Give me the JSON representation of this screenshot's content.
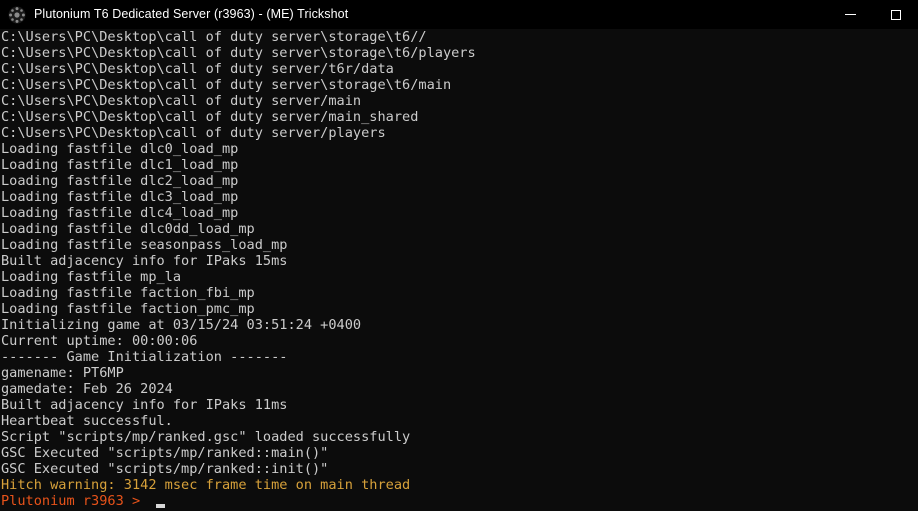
{
  "titlebar": {
    "icon": "plutonium-logo-icon",
    "title": "Plutonium T6 Dedicated Server (r3963) - (ME) Trickshot",
    "minimize_label": "Minimize",
    "maximize_label": "Maximize"
  },
  "colors": {
    "background": "#0c0c0c",
    "titlebar_background": "#000000",
    "text": "#cccccc",
    "warning": "#d7a13a",
    "prompt": "#e8531a",
    "cursor": "#d8d8d8"
  },
  "console": {
    "lines": [
      {
        "text": "C:\\Users\\PC\\Desktop\\call of duty server\\storage\\t6//",
        "style": "normal"
      },
      {
        "text": "C:\\Users\\PC\\Desktop\\call of duty server\\storage\\t6/players",
        "style": "normal"
      },
      {
        "text": "C:\\Users\\PC\\Desktop\\call of duty server/t6r/data",
        "style": "normal"
      },
      {
        "text": "C:\\Users\\PC\\Desktop\\call of duty server\\storage\\t6/main",
        "style": "normal"
      },
      {
        "text": "C:\\Users\\PC\\Desktop\\call of duty server/main",
        "style": "normal"
      },
      {
        "text": "C:\\Users\\PC\\Desktop\\call of duty server/main_shared",
        "style": "normal"
      },
      {
        "text": "C:\\Users\\PC\\Desktop\\call of duty server/players",
        "style": "normal"
      },
      {
        "text": "Loading fastfile dlc0_load_mp",
        "style": "normal"
      },
      {
        "text": "Loading fastfile dlc1_load_mp",
        "style": "normal"
      },
      {
        "text": "Loading fastfile dlc2_load_mp",
        "style": "normal"
      },
      {
        "text": "Loading fastfile dlc3_load_mp",
        "style": "normal"
      },
      {
        "text": "Loading fastfile dlc4_load_mp",
        "style": "normal"
      },
      {
        "text": "Loading fastfile dlc0dd_load_mp",
        "style": "normal"
      },
      {
        "text": "Loading fastfile seasonpass_load_mp",
        "style": "normal"
      },
      {
        "text": "Built adjacency info for IPaks 15ms",
        "style": "normal"
      },
      {
        "text": "Loading fastfile mp_la",
        "style": "normal"
      },
      {
        "text": "Loading fastfile faction_fbi_mp",
        "style": "normal"
      },
      {
        "text": "Loading fastfile faction_pmc_mp",
        "style": "normal"
      },
      {
        "text": "Initializing game at 03/15/24 03:51:24 +0400",
        "style": "normal"
      },
      {
        "text": "Current uptime: 00:00:06",
        "style": "normal"
      },
      {
        "text": "------- Game Initialization -------",
        "style": "normal"
      },
      {
        "text": "gamename: PT6MP",
        "style": "normal"
      },
      {
        "text": "gamedate: Feb 26 2024",
        "style": "normal"
      },
      {
        "text": "Built adjacency info for IPaks 11ms",
        "style": "normal"
      },
      {
        "text": "Heartbeat successful.",
        "style": "normal"
      },
      {
        "text": "Script \"scripts/mp/ranked.gsc\" loaded successfully",
        "style": "normal"
      },
      {
        "text": "GSC Executed \"scripts/mp/ranked::main()\"",
        "style": "normal"
      },
      {
        "text": "GSC Executed \"scripts/mp/ranked::init()\"",
        "style": "normal"
      },
      {
        "text": "Hitch warning: 3142 msec frame time on main thread",
        "style": "warn"
      },
      {
        "text": "Plutonium r3963 > ",
        "style": "prompt"
      }
    ]
  }
}
